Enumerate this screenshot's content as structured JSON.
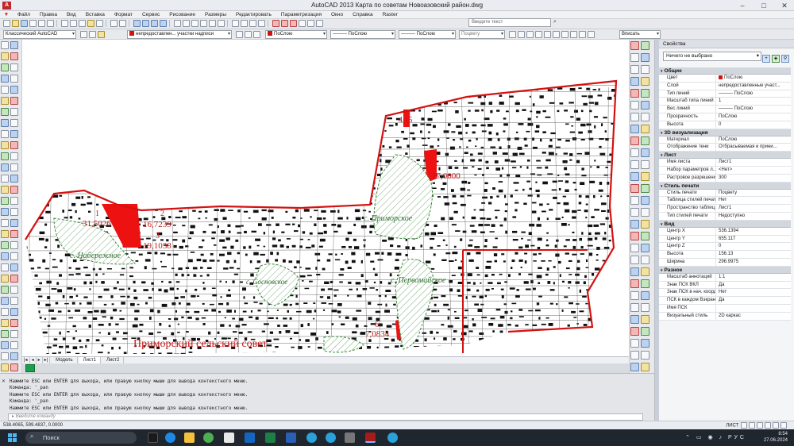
{
  "app": {
    "title": "AutoCAD 2013    Карта по советам Новоазовский район.dwg",
    "logo": "A"
  },
  "menu": [
    "Файл",
    "Правка",
    "Вид",
    "Вставка",
    "Формат",
    "Сервис",
    "Рисование",
    "Размеры",
    "Редактировать",
    "Параметризация",
    "Окно",
    "Справка",
    "Raster"
  ],
  "search": {
    "placeholder": "Введите текст"
  },
  "toolbar2": {
    "workspace": "Классический AutoCAD",
    "layer": "непредоставлен... участки надписи",
    "color": "ПоСлою",
    "linetype": "——— ПоСлою",
    "lineweight": "——— ПоСлою",
    "plotstyle": "Поцвету",
    "zoom": "Вписать"
  },
  "map_labels": {
    "parcel1_num": "1",
    "parcel1_val": "31,5026",
    "parcel2_num": "2",
    "parcel2_val": "16,7239",
    "parcel3_num": "3",
    "parcel3_val": "19,1038",
    "parcel4_val": "4,15",
    "parcel5_val": "17,0000",
    "parcel6_num": "6",
    "parcel6_val": "7,0834",
    "village_naberezhnoe": "с. Набережное",
    "village_primorskoe": "с. Приморское",
    "village_sosnovskoe": "с. Сосновское",
    "village_pervomayskoe": "с. Первомайское",
    "council": "Приморский сельский совет"
  },
  "layout_tabs": [
    "Модель",
    "Лист1",
    "Лист2"
  ],
  "properties": {
    "title": "Свойства",
    "selection": "Ничего не выбрано",
    "sections": [
      {
        "name": "Общие",
        "rows": [
          {
            "k": "Цвет",
            "v": "ПоСлою",
            "swatch": "#d41111"
          },
          {
            "k": "Слой",
            "v": "непредоставленные участ..."
          },
          {
            "k": "Тип линий",
            "v": "——— ПоСлою"
          },
          {
            "k": "Масштаб типа линий",
            "v": "1"
          },
          {
            "k": "Вес линий",
            "v": "——— ПоСлою"
          },
          {
            "k": "Прозрачность",
            "v": "ПоСлою"
          },
          {
            "k": "Высота",
            "v": "0"
          }
        ]
      },
      {
        "name": "3D визуализация",
        "rows": [
          {
            "k": "Материал",
            "v": "ПоСлою"
          },
          {
            "k": "Отображение тени",
            "v": "Отбрасываемая и прини..."
          }
        ]
      },
      {
        "name": "Лист",
        "rows": [
          {
            "k": "Имя листа",
            "v": "Лист1"
          },
          {
            "k": "Набор параметров л...",
            "v": "<Нет>"
          },
          {
            "k": "Растровое разрешение",
            "v": "300"
          }
        ]
      },
      {
        "name": "Стиль печати",
        "rows": [
          {
            "k": "Стиль печати",
            "v": "Поцвету"
          },
          {
            "k": "Таблица стилей печати",
            "v": "Нет"
          },
          {
            "k": "Пространство таблиц...",
            "v": "Лист1"
          },
          {
            "k": "Тип стилей печати",
            "v": "Недоступно"
          }
        ]
      },
      {
        "name": "Вид",
        "rows": [
          {
            "k": "Центр X",
            "v": "536.1394"
          },
          {
            "k": "Центр Y",
            "v": "655.117"
          },
          {
            "k": "Центр Z",
            "v": "0"
          },
          {
            "k": "Высота",
            "v": "156.13"
          },
          {
            "k": "Ширина",
            "v": "296.9975"
          }
        ]
      },
      {
        "name": "Разное",
        "rows": [
          {
            "k": "Масштаб аннотаций",
            "v": "1:1"
          },
          {
            "k": "Знак ПСК ВКЛ",
            "v": "Да"
          },
          {
            "k": "Знак ПСК в нач. коорд.",
            "v": "Нет"
          },
          {
            "k": "ПСК в каждом Вэкране",
            "v": "Да"
          },
          {
            "k": "Имя ПСК",
            "v": ""
          },
          {
            "k": "Визуальный стиль",
            "v": "2D каркас"
          }
        ]
      }
    ]
  },
  "command_line": {
    "history": [
      "Нажмите ESC или ENTER для выхода, или правую кнопку мыши для вывода контекстного меню.",
      "Команда: '_pan",
      "Нажмите ESC или ENTER для выхода, или правую кнопку мыши для вывода контекстного меню.",
      "Команда: '_pan",
      "Нажмите ESC или ENTER для выхода, или правую кнопку мыши для вывода контекстного меню."
    ],
    "placeholder": "Введите команду"
  },
  "status": {
    "coords": "538.4065, 599.4837, 0.0000",
    "space": "ЛИСТ"
  },
  "taskbar": {
    "search": "Поиск",
    "lang": "РУС",
    "time": "8:54",
    "date": "27.06.2024"
  },
  "colors": {
    "boundary": "#d41111",
    "village_hatch": "#3e8a3e",
    "parcels": "#111111"
  }
}
